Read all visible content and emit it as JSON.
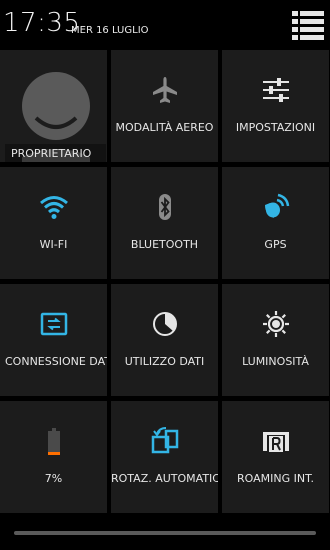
{
  "status": {
    "time": "17:35",
    "date": "MER 16 LUGLIO"
  },
  "tiles": [
    {
      "label": "PROPRIETARIO",
      "icon": "avatar-icon"
    },
    {
      "label": "MODALITÀ AEREO",
      "icon": "airplane-icon"
    },
    {
      "label": "IMPOSTAZIONI",
      "icon": "settings-sliders-icon"
    },
    {
      "label": "WI-FI",
      "icon": "wifi-icon",
      "active": true
    },
    {
      "label": "BLUETOOTH",
      "icon": "bluetooth-icon"
    },
    {
      "label": "GPS",
      "icon": "gps-icon",
      "active": true
    },
    {
      "label": "CONNESSIONE DATI",
      "icon": "data-connection-icon",
      "active": true
    },
    {
      "label": "UTILIZZO DATI",
      "icon": "data-usage-icon"
    },
    {
      "label": "LUMINOSITÀ",
      "icon": "brightness-icon"
    },
    {
      "label": "7%",
      "icon": "battery-icon"
    },
    {
      "label": "ROTAZ. AUTOMATICA",
      "icon": "auto-rotate-icon",
      "active": true
    },
    {
      "label": "ROAMING INT.",
      "icon": "roaming-icon"
    }
  ],
  "colors": {
    "accent": "#33b5e5",
    "tile": "#1c1c1c",
    "background": "#000000",
    "inactive": "#8a8a8a",
    "battery_low": "#ff6f00"
  }
}
